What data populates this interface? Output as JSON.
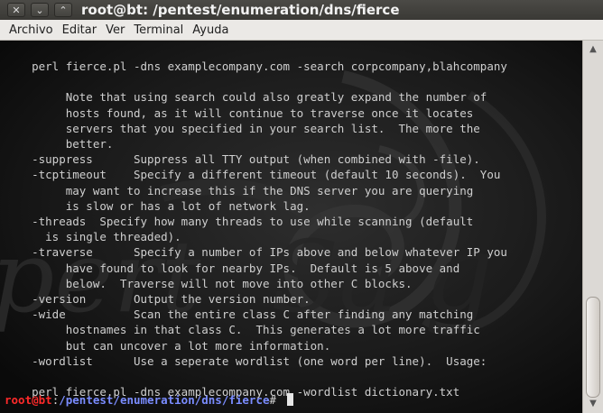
{
  "window": {
    "title": "root@bt: /pentest/enumeration/dns/fierce",
    "buttons": {
      "close": "✕",
      "minimize": "⌄",
      "maximize": "⌃"
    }
  },
  "menubar": [
    "Archivo",
    "Editar",
    "Ver",
    "Terminal",
    "Ayuda"
  ],
  "terminal": {
    "lines": [
      "    perl fierce.pl -dns examplecompany.com -search corpcompany,blahcompany",
      "",
      "         Note that using search could also greatly expand the number of",
      "         hosts found, as it will continue to traverse once it locates",
      "         servers that you specified in your search list.  The more the",
      "         better.",
      "    -suppress      Suppress all TTY output (when combined with -file).",
      "    -tcptimeout    Specify a different timeout (default 10 seconds).  You",
      "         may want to increase this if the DNS server you are querying",
      "         is slow or has a lot of network lag.",
      "    -threads  Specify how many threads to use while scanning (default",
      "      is single threaded).",
      "    -traverse      Specify a number of IPs above and below whatever IP you",
      "         have found to look for nearby IPs.  Default is 5 above and",
      "         below.  Traverse will not move into other C blocks.",
      "    -version       Output the version number.",
      "    -wide          Scan the entire class C after finding any matching",
      "         hostnames in that class C.  This generates a lot more traffic",
      "         but can uncover a lot more information.",
      "    -wordlist      Use a seperate wordlist (one word per line).  Usage:",
      "",
      "    perl fierce.pl -dns examplecompany.com -wordlist dictionary.txt"
    ],
    "prompt": {
      "user_host": "root@bt",
      "separator": ":",
      "path": "/pentest/enumeration/dns/fierce",
      "symbol": "# "
    }
  },
  "scrollbar": {
    "up": "▲",
    "down": "▼",
    "position": 0.92
  }
}
